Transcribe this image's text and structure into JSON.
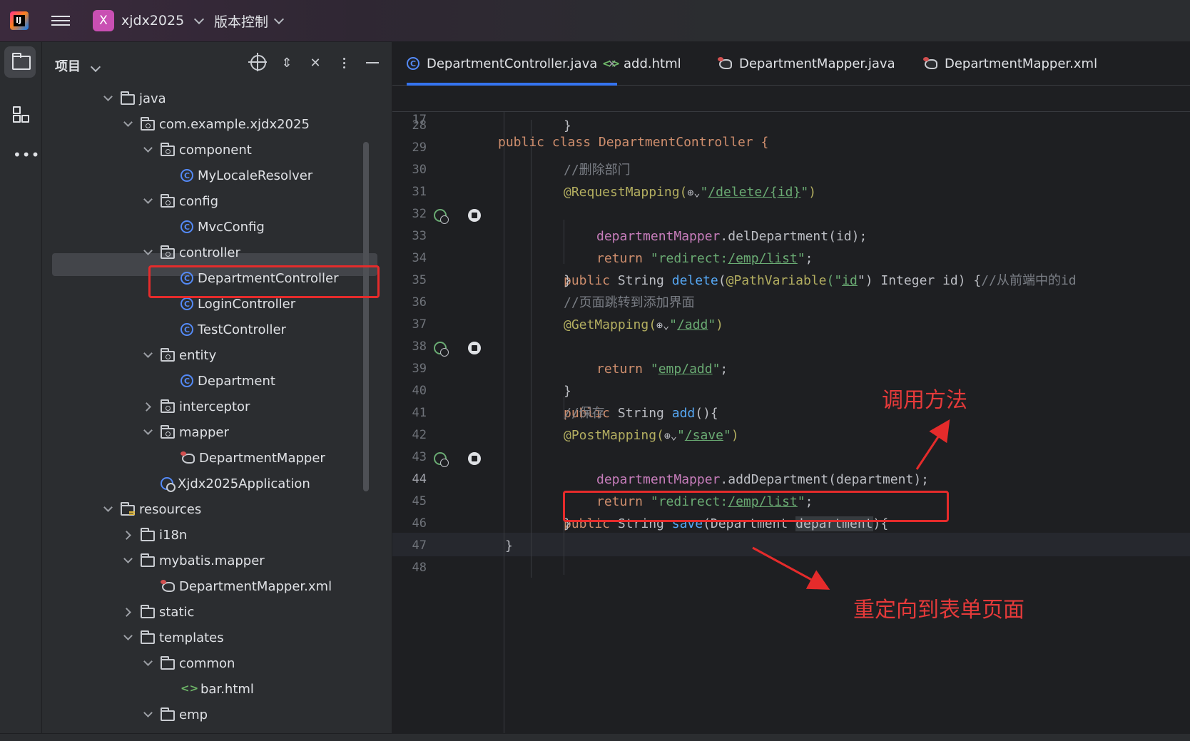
{
  "titlebar": {
    "project_badge": "X",
    "project_name": "xjdx2025",
    "vcs_label": "版本控制"
  },
  "project_panel": {
    "title": "项目",
    "tree": [
      {
        "label": "java",
        "type": "folder",
        "depth": 1,
        "expanded": true
      },
      {
        "label": "com.example.xjdx2025",
        "type": "package",
        "depth": 2,
        "expanded": true
      },
      {
        "label": "component",
        "type": "package",
        "depth": 3,
        "expanded": true
      },
      {
        "label": "MyLocaleResolver",
        "type": "class",
        "depth": 4
      },
      {
        "label": "config",
        "type": "package",
        "depth": 3,
        "expanded": true
      },
      {
        "label": "MvcConfig",
        "type": "class",
        "depth": 4
      },
      {
        "label": "controller",
        "type": "package",
        "depth": 3,
        "expanded": true
      },
      {
        "label": "DepartmentController",
        "type": "class",
        "depth": 4,
        "selected": true
      },
      {
        "label": "LoginController",
        "type": "class",
        "depth": 4
      },
      {
        "label": "TestController",
        "type": "class",
        "depth": 4
      },
      {
        "label": "entity",
        "type": "package",
        "depth": 3,
        "expanded": true
      },
      {
        "label": "Department",
        "type": "class",
        "depth": 4
      },
      {
        "label": "interceptor",
        "type": "package",
        "depth": 3,
        "expanded": false
      },
      {
        "label": "mapper",
        "type": "package",
        "depth": 3,
        "expanded": true
      },
      {
        "label": "DepartmentMapper",
        "type": "mybatis",
        "depth": 4
      },
      {
        "label": "Xjdx2025Application",
        "type": "app",
        "depth": 3
      },
      {
        "label": "resources",
        "type": "resources",
        "depth": 1,
        "expanded": true
      },
      {
        "label": "i18n",
        "type": "folder",
        "depth": 2,
        "expanded": false
      },
      {
        "label": "mybatis.mapper",
        "type": "folder",
        "depth": 2,
        "expanded": true
      },
      {
        "label": "DepartmentMapper.xml",
        "type": "mybatis",
        "depth": 3
      },
      {
        "label": "static",
        "type": "folder",
        "depth": 2,
        "expanded": false
      },
      {
        "label": "templates",
        "type": "folder",
        "depth": 2,
        "expanded": true
      },
      {
        "label": "common",
        "type": "folder",
        "depth": 3,
        "expanded": true
      },
      {
        "label": "bar.html",
        "type": "html",
        "depth": 4
      },
      {
        "label": "emp",
        "type": "folder",
        "depth": 3,
        "expanded": true
      }
    ]
  },
  "tabs": [
    {
      "label": "DepartmentController.java",
      "icon": "class-icon",
      "active": true
    },
    {
      "label": "add.html",
      "icon": "html-icon"
    },
    {
      "label": "DepartmentMapper.java",
      "icon": "mybatis-icon"
    },
    {
      "label": "DepartmentMapper.xml",
      "icon": "mybatis-icon"
    }
  ],
  "editor": {
    "sticky_line_number": "17",
    "sticky_line": "public class DepartmentController {",
    "current_line": "44",
    "lines": [
      {
        "n": "28"
      },
      {
        "n": "29"
      },
      {
        "n": "30"
      },
      {
        "n": "31"
      },
      {
        "n": "32"
      },
      {
        "n": "33"
      },
      {
        "n": "34"
      },
      {
        "n": "35"
      },
      {
        "n": "36"
      },
      {
        "n": "37"
      },
      {
        "n": "38"
      },
      {
        "n": "39"
      },
      {
        "n": "40"
      },
      {
        "n": "41"
      },
      {
        "n": "42"
      },
      {
        "n": "43"
      },
      {
        "n": "44"
      },
      {
        "n": "45"
      },
      {
        "n": "46"
      },
      {
        "n": "47"
      },
      {
        "n": "48"
      }
    ],
    "code": {
      "l28": "}",
      "l30": "//删除部门",
      "l31_ann": "@RequestMapping(",
      "l31_url": "/delete/{id}",
      "l32_pub": "public",
      "l32_type": " String ",
      "l32_fn": "delete",
      "l32_open": "(",
      "l32_ann": "@PathVariable",
      "l32_q": "(\"",
      "l32_id": "id",
      "l32_rest": "\") Integer id) {",
      "l32_cmt": "//从前端中的id",
      "l33_fld": "departmentMapper",
      "l33_rest": ".delDepartment(id);",
      "l34_ret": "return",
      "l34_s1": " \"redirect:",
      "l34_url": "/emp/list",
      "l34_s2": "\"",
      "l34_semi": ";",
      "l35": "}",
      "l36": "//页面跳转到添加界面",
      "l37_ann": "@GetMapping(",
      "l37_url": "/add",
      "l38_pub": "public",
      "l38_type": " String ",
      "l38_fn": "add",
      "l38_rest": "(){",
      "l39_ret": "return",
      "l39_s1": " \"",
      "l39_url": "emp/add",
      "l39_s2": "\"",
      "l39_semi": ";",
      "l40": "}",
      "l41": "//保存",
      "l42_ann": "@PostMapping(",
      "l42_url": "/save",
      "l43_pub": "public",
      "l43_type": " String ",
      "l43_fn": "save",
      "l43_open": "(Department ",
      "l43_param": "department",
      "l43_close": "){",
      "l44_fld": "departmentMapper",
      "l44_rest": ".addDepartment(department);",
      "l45_ret": "return",
      "l45_s1": " \"redirect:",
      "l45_url": "/emp/list",
      "l45_s2": "\"",
      "l45_semi": ";",
      "l46": "}",
      "l47": "}"
    }
  },
  "annotations": {
    "call_method": "调用方法",
    "redirect_to_form": "重定向到表单页面"
  },
  "colors": {
    "highlight_red": "#e52b2b",
    "accent_blue": "#3574f0"
  }
}
